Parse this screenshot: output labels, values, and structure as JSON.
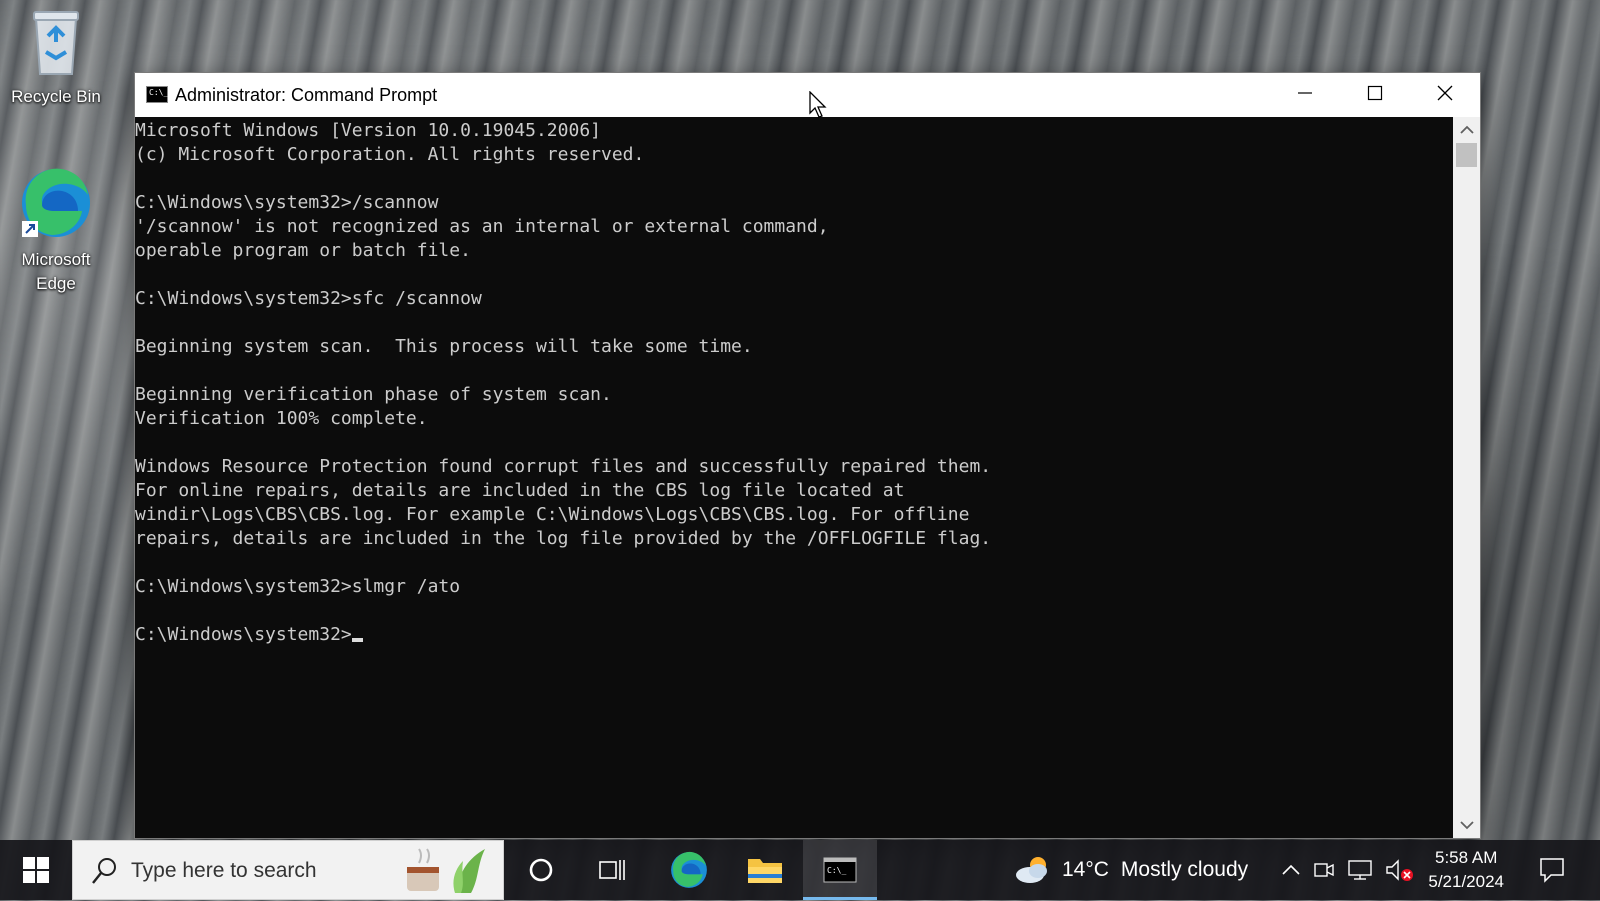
{
  "desktop": {
    "icons": [
      {
        "label": "Recycle Bin"
      },
      {
        "label_line1": "Microsoft",
        "label_line2": "Edge"
      }
    ]
  },
  "window": {
    "title": "Administrator: Command Prompt",
    "console_lines": [
      "Microsoft Windows [Version 10.0.19045.2006]",
      "(c) Microsoft Corporation. All rights reserved.",
      "",
      "C:\\Windows\\system32>/scannow",
      "'/scannow' is not recognized as an internal or external command,",
      "operable program or batch file.",
      "",
      "C:\\Windows\\system32>sfc /scannow",
      "",
      "Beginning system scan.  This process will take some time.",
      "",
      "Beginning verification phase of system scan.",
      "Verification 100% complete.",
      "",
      "Windows Resource Protection found corrupt files and successfully repaired them.",
      "For online repairs, details are included in the CBS log file located at",
      "windir\\Logs\\CBS\\CBS.log. For example C:\\Windows\\Logs\\CBS\\CBS.log. For offline",
      "repairs, details are included in the log file provided by the /OFFLOGFILE flag.",
      "",
      "C:\\Windows\\system32>slmgr /ato",
      ""
    ],
    "prompt": "C:\\Windows\\system32>"
  },
  "taskbar": {
    "search_placeholder": "Type here to search",
    "weather": {
      "temp": "14°C",
      "condition": "Mostly cloudy"
    },
    "clock": {
      "time": "5:58 AM",
      "date": "5/21/2024"
    }
  },
  "colors": {
    "console_bg": "#0c0c0c",
    "console_fg": "#cccccc",
    "taskbar_bg": "#16161a",
    "accent": "#76b9ed"
  }
}
